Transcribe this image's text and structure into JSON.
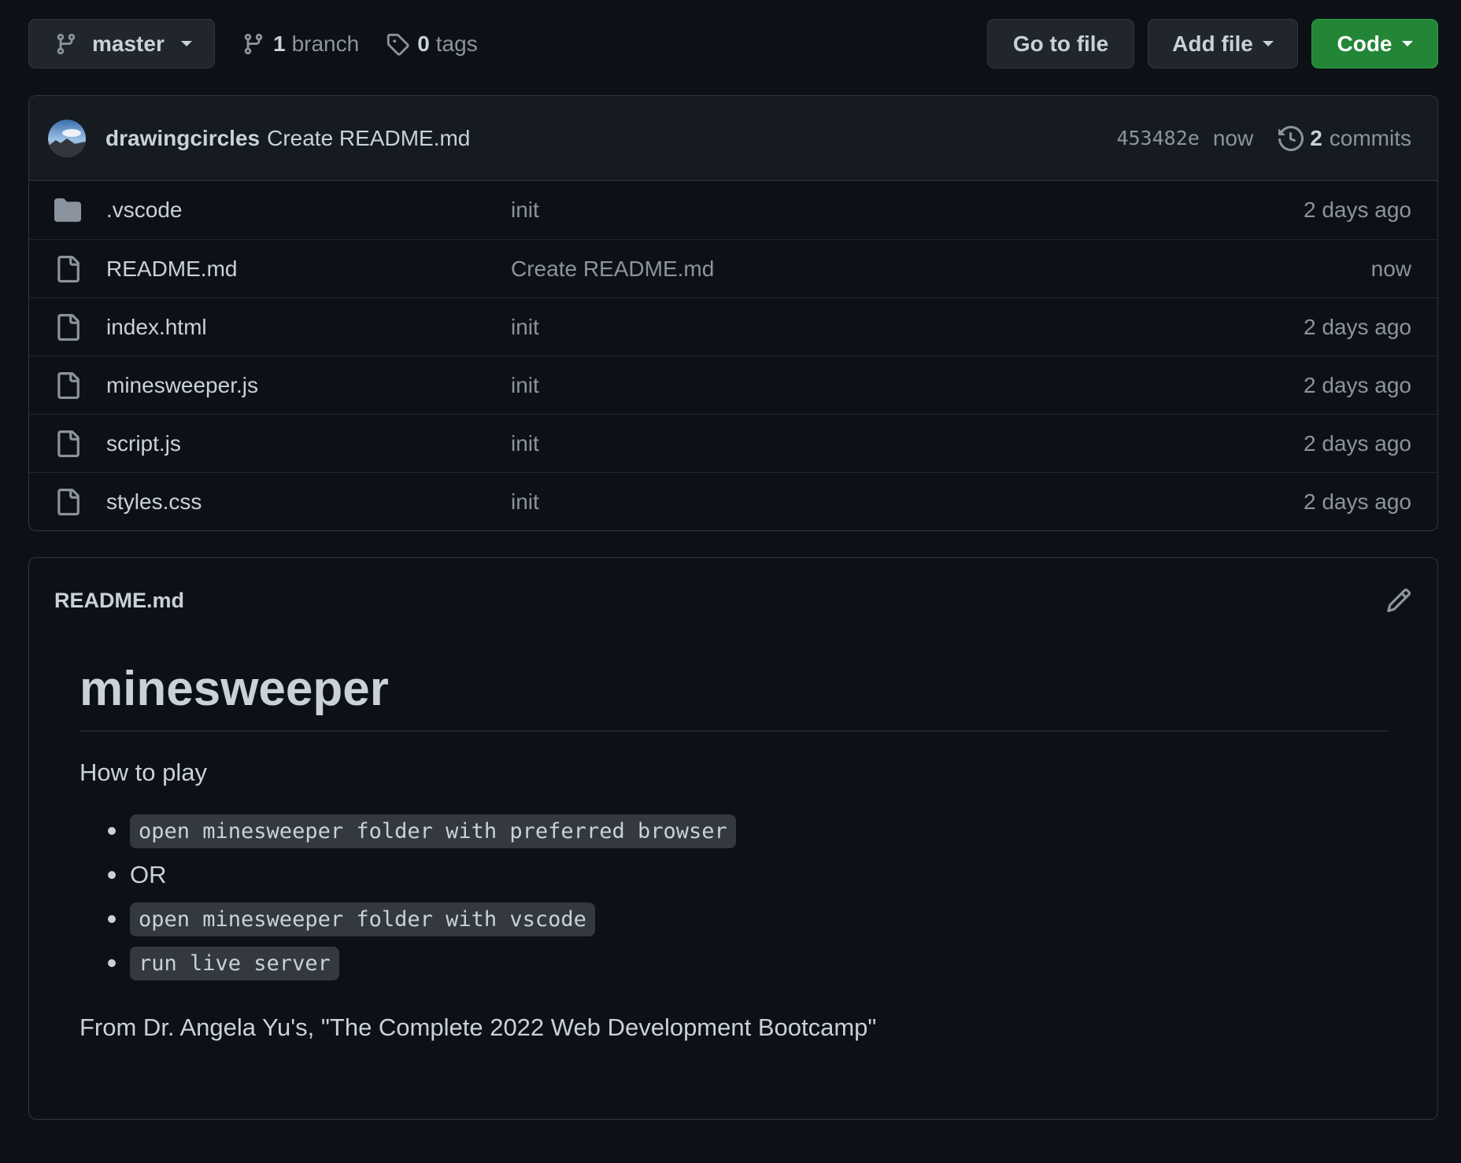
{
  "toolbar": {
    "branch_name": "master",
    "branch_count": "1",
    "branch_label": "branch",
    "tag_count": "0",
    "tag_label": "tags",
    "go_to_file": "Go to file",
    "add_file": "Add file",
    "code": "Code"
  },
  "latest_commit": {
    "author": "drawingcircles",
    "message": "Create README.md",
    "sha": "453482e",
    "time": "now",
    "commit_count": "2",
    "commit_label": "commits"
  },
  "files": [
    {
      "name": ".vscode",
      "type": "folder",
      "message": "init",
      "age": "2 days ago"
    },
    {
      "name": "README.md",
      "type": "file",
      "message": "Create README.md",
      "age": "now"
    },
    {
      "name": "index.html",
      "type": "file",
      "message": "init",
      "age": "2 days ago"
    },
    {
      "name": "minesweeper.js",
      "type": "file",
      "message": "init",
      "age": "2 days ago"
    },
    {
      "name": "script.js",
      "type": "file",
      "message": "init",
      "age": "2 days ago"
    },
    {
      "name": "styles.css",
      "type": "file",
      "message": "init",
      "age": "2 days ago"
    }
  ],
  "readme": {
    "filename": "README.md",
    "heading": "minesweeper",
    "intro": "How to play",
    "items": [
      "open minesweeper folder with preferred browser",
      "OR",
      "open minesweeper folder with vscode",
      "run live server"
    ],
    "footer": "From Dr. Angela Yu's, \"The Complete 2022 Web Development Bootcamp\""
  },
  "colors": {
    "background": "#0d1117",
    "code_button": "#238636",
    "border": "#30363d",
    "muted_text": "#8b949e"
  },
  "icons": [
    "branch-icon",
    "tag-icon",
    "history-icon",
    "folder-icon",
    "file-icon",
    "pencil-icon"
  ]
}
